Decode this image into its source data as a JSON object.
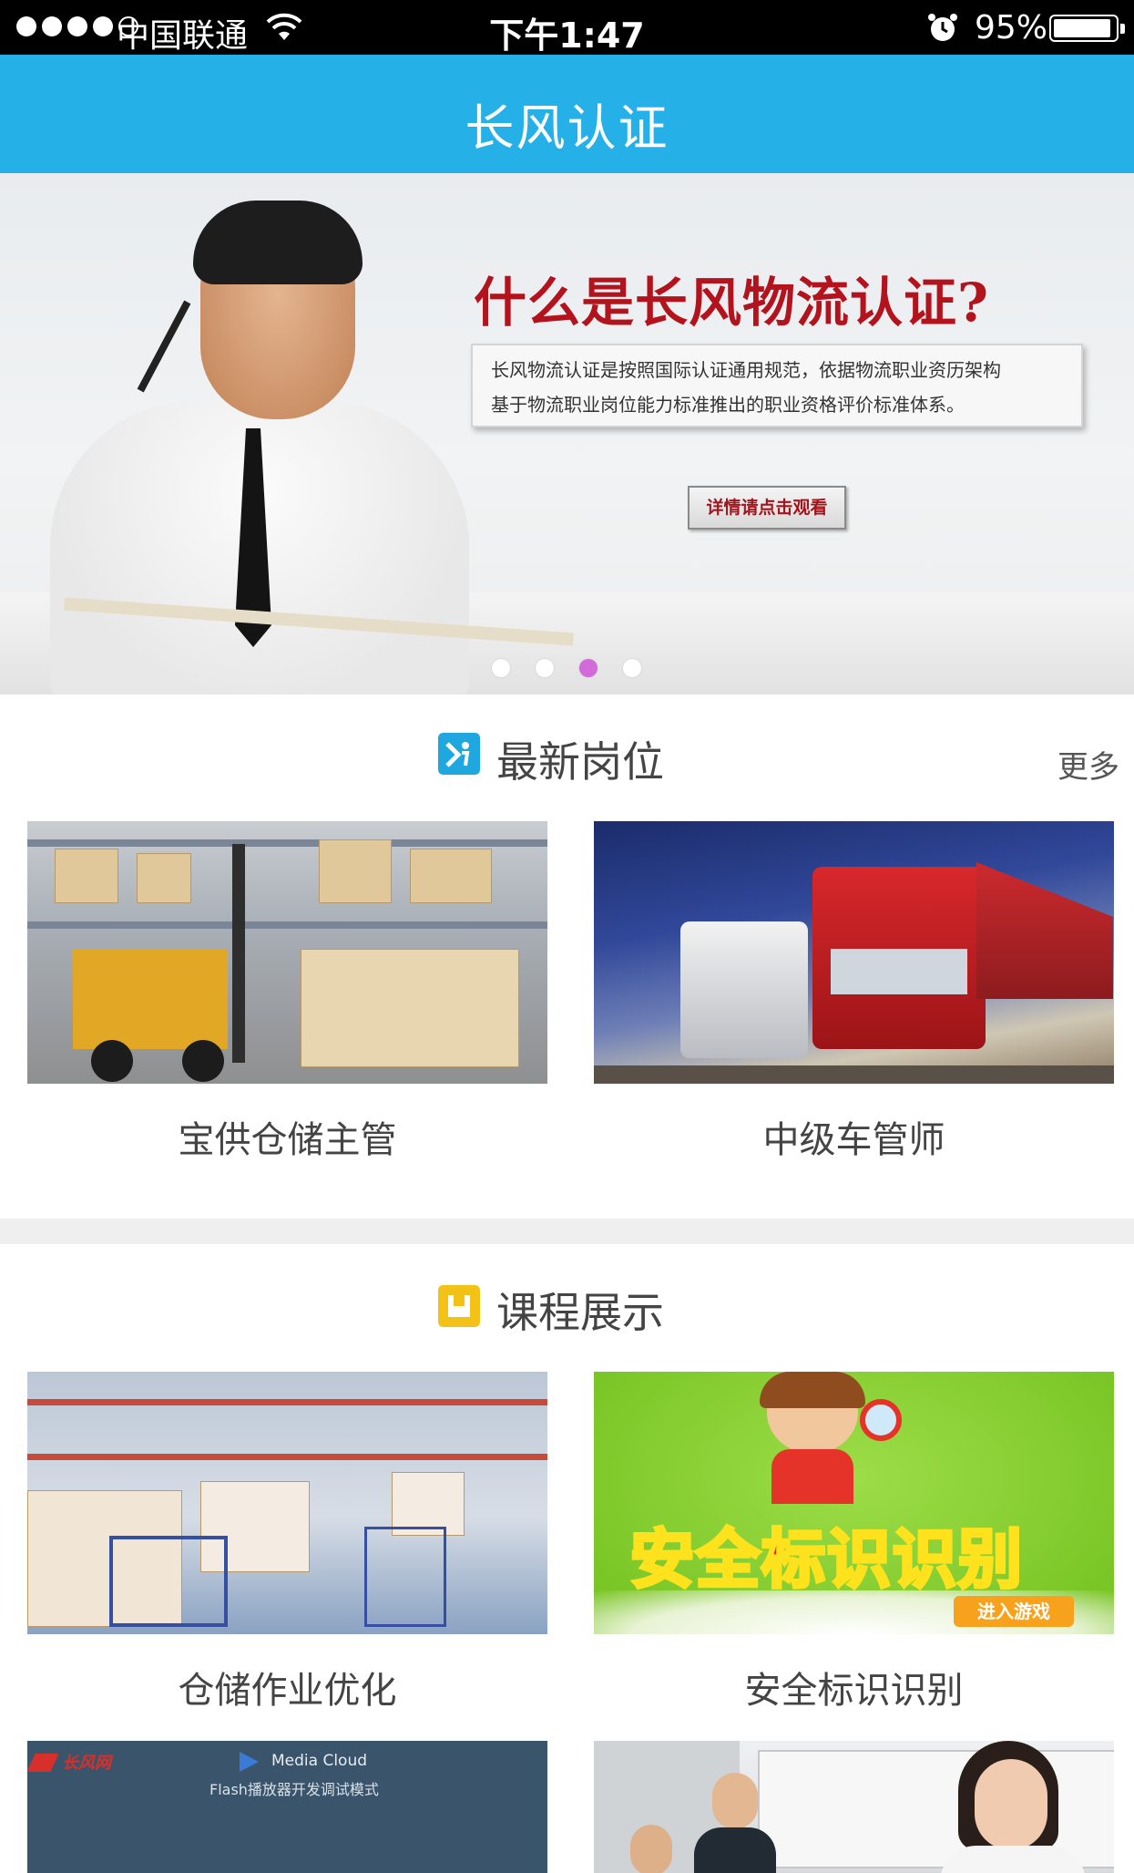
{
  "status_bar": {
    "carrier": "中国联通",
    "time": "下午1:47",
    "battery": "95%",
    "battery_level": 0.95
  },
  "nav": {
    "title": "长风认证"
  },
  "banner": {
    "headline": "什么是长风物流认证?",
    "description_line1": "长风物流认证是按照国际认证通用规范，依据物流职业资历架构",
    "description_line2": "基于物流职业岗位能力标准推出的职业资格评价标准体系。",
    "button": "详情请点击观看",
    "page_count": 4,
    "active_page": 3
  },
  "jobs": {
    "title": "最新岗位",
    "more": "更多",
    "items": [
      {
        "label": "宝供仓储主管"
      },
      {
        "label": "中级车管师"
      }
    ]
  },
  "courses": {
    "title": "课程展示",
    "items": [
      {
        "label": "仓储作业优化"
      },
      {
        "label": "安全标识识别",
        "image_text": "安全标识识别",
        "image_button": "进入游戏"
      },
      {
        "label": "",
        "image_brand": "长风网",
        "image_title": "Media Cloud",
        "image_subtitle": "Flash播放器开发调试模式"
      },
      {
        "label": ""
      }
    ]
  },
  "colors": {
    "nav": "#25b0e8",
    "jobs_icon": "#1fa8e0",
    "courses_icon": "#f2c316",
    "pager_active": "#d36ad9",
    "headline": "#b3131c"
  }
}
